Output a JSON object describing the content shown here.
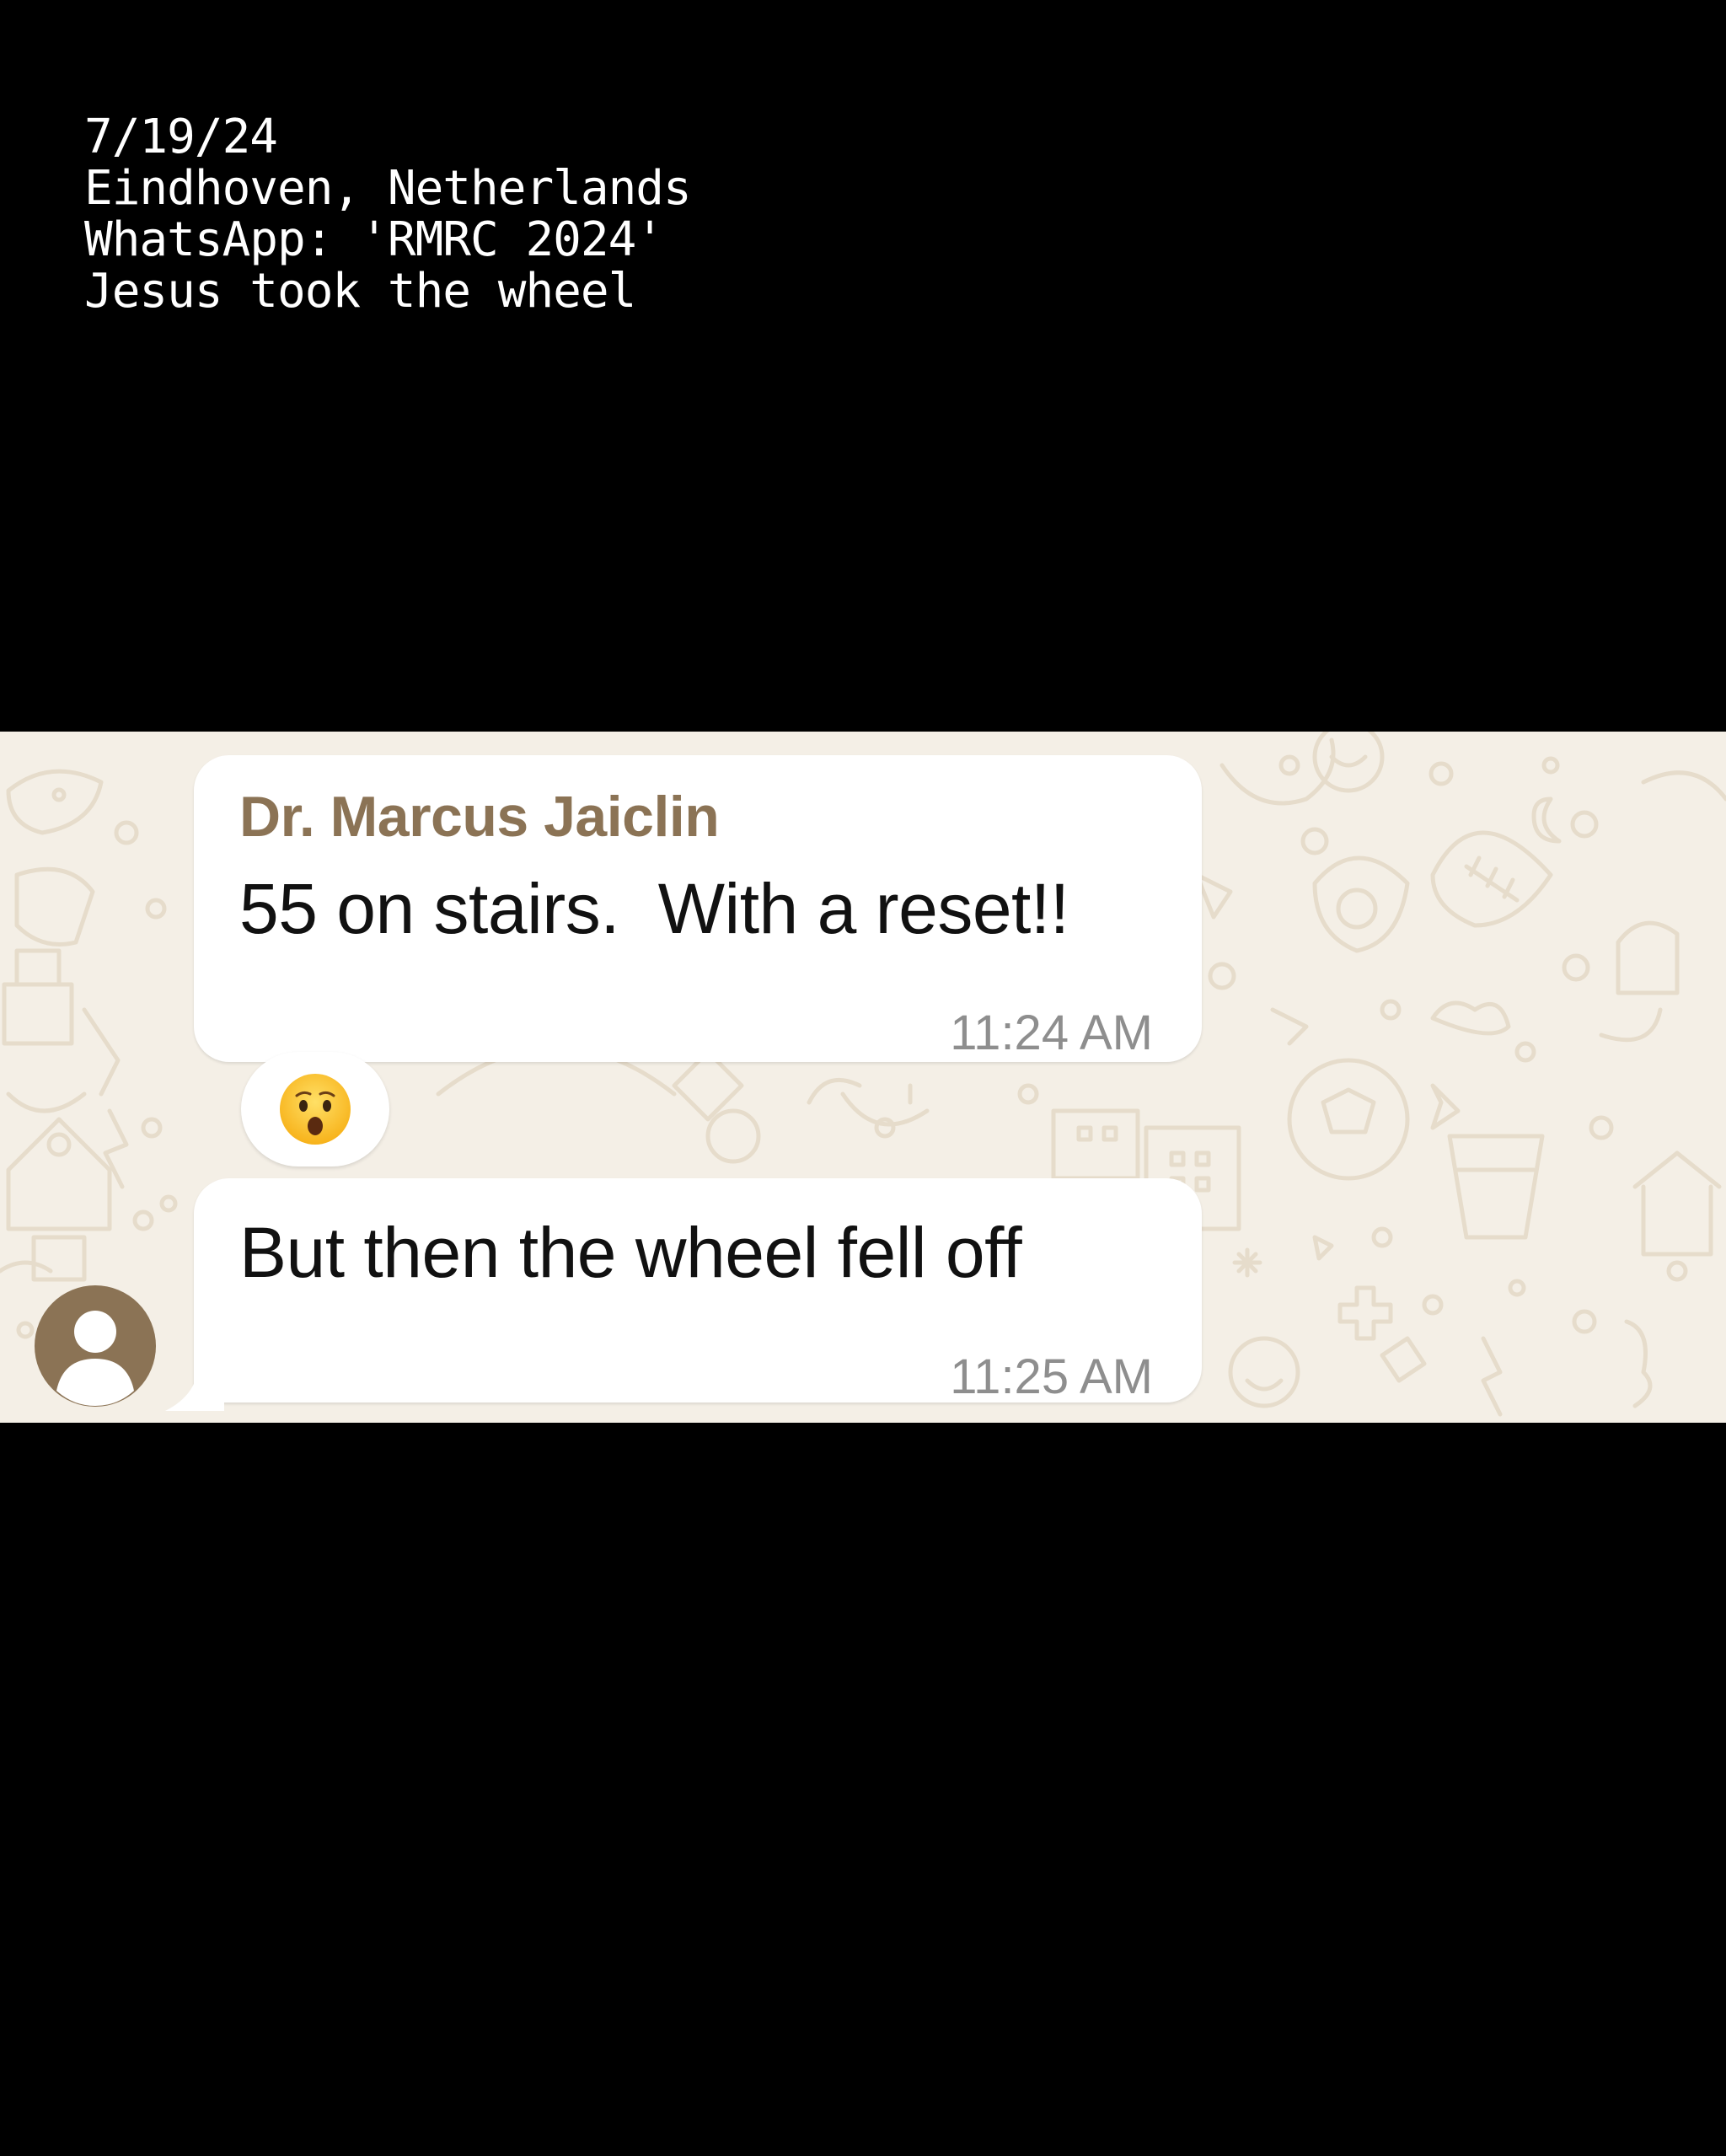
{
  "caption": {
    "date": "7/19/24",
    "location": "Eindhoven, Netherlands",
    "source": "WhatsApp: 'RMRC 2024'",
    "title": "Jesus took the wheel"
  },
  "chat": {
    "colors": {
      "background": "#f4efe6",
      "sender_name": "#8b7355",
      "bubble": "#ffffff",
      "timestamp": "#8e8e8e"
    },
    "messages": [
      {
        "sender": "Dr. Marcus Jaiclin",
        "text": "55 on stairs.  With a reset!!",
        "time": "11:24 AM",
        "reaction": "astonished-face-emoji"
      },
      {
        "text": "But then the wheel fell off",
        "time": "11:25 AM"
      }
    ],
    "avatar_icon": "default-person-avatar-icon"
  }
}
